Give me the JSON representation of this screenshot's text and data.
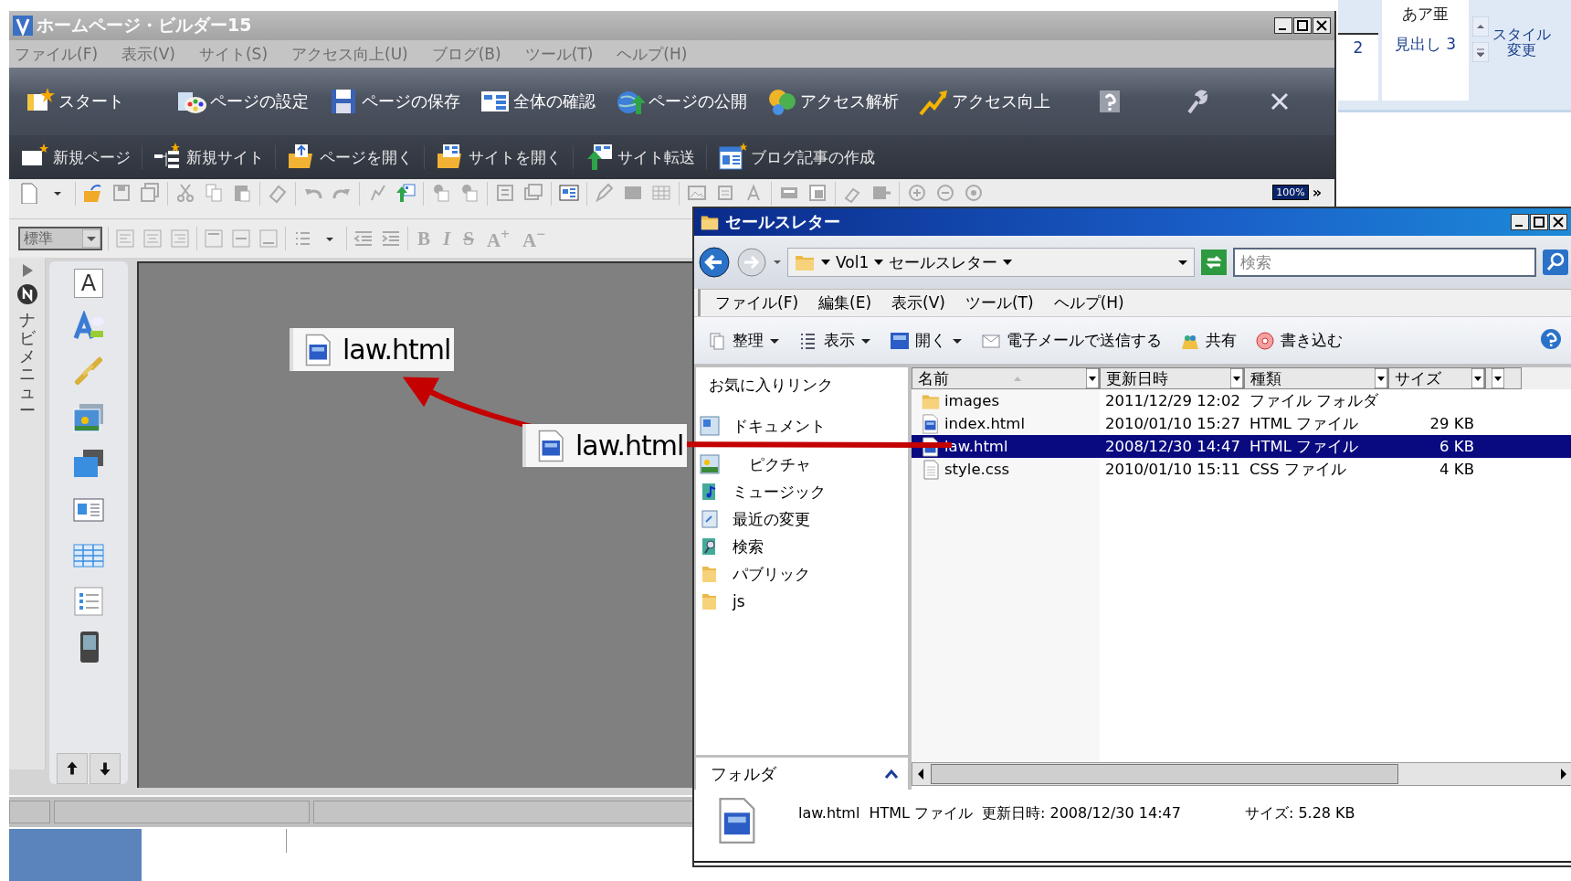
{
  "app": {
    "title": "ホームページ・ビルダー15",
    "menu": [
      "ファイル(F)",
      "表示(V)",
      "サイト(S)",
      "アクセス向上(U)",
      "ブログ(B)",
      "ツール(T)",
      "ヘルプ(H)"
    ],
    "main_toolbar": [
      "スタート",
      "ページの設定",
      "ページの保存",
      "全体の確認",
      "ページの公開",
      "アクセス解析",
      "アクセス向上"
    ],
    "sub_toolbar": [
      "新規ページ",
      "新規サイト",
      "ページを開く",
      "サイトを開く",
      "サイト転送",
      "ブログ記事の作成"
    ],
    "zoom": "100%",
    "more": "»",
    "style_select": "標準",
    "format_buttons": [
      "B",
      "I",
      "S",
      "A$^{+}$",
      "A$^{−}$"
    ],
    "navi_tab": "ナビメニュー",
    "palette_text_tool": "A"
  },
  "canvas_item": "law.html",
  "drag_ghost": "law.html",
  "ribbon": {
    "top": "あア亜",
    "fragment": "2",
    "heading": "見出し 3",
    "style_change": [
      "スタイル",
      "変更"
    ]
  },
  "explorer": {
    "title": "セールスレター",
    "breadcrumb": [
      "Vol1",
      "セールスレター"
    ],
    "search": {
      "placeholder": "検索"
    },
    "menu": [
      "ファイル(F)",
      "編集(E)",
      "表示(V)",
      "ツール(T)",
      "ヘルプ(H)"
    ],
    "toolbar": [
      "整理",
      "表示",
      "開く",
      "電子メールで送信する",
      "共有",
      "書き込む"
    ],
    "favorites_title": "お気に入りリンク",
    "favorites": [
      {
        "label": "ドキュメント",
        "kind": "documents"
      },
      {
        "label": "ピクチャ",
        "kind": "pictures"
      },
      {
        "label": "ミュージック",
        "kind": "music"
      },
      {
        "label": "最近の変更",
        "kind": "recent"
      },
      {
        "label": "検索",
        "kind": "search"
      },
      {
        "label": "パブリック",
        "kind": "folder"
      },
      {
        "label": "js",
        "kind": "folder"
      }
    ],
    "folders_label": "フォルダ",
    "columns": [
      "名前",
      "更新日時",
      "種類",
      "サイズ"
    ],
    "rows": [
      {
        "name": "images",
        "modified": "2011/12/29 12:02",
        "type": "ファイル フォルダ",
        "size": "",
        "kind": "folder",
        "selected": false
      },
      {
        "name": "index.html",
        "modified": "2010/01/10 15:27",
        "type": "HTML ファイル",
        "size": "29 KB",
        "kind": "html",
        "selected": false
      },
      {
        "name": "law.html",
        "modified": "2008/12/30 14:47",
        "type": "HTML ファイル",
        "size": "6 KB",
        "kind": "html",
        "selected": true
      },
      {
        "name": "style.css",
        "modified": "2010/01/10 15:11",
        "type": "CSS ファイル",
        "size": "4 KB",
        "kind": "css",
        "selected": false
      }
    ],
    "details": {
      "name": "law.html",
      "type": "HTML ファイル",
      "modified": "更新日時: 2008/12/30 14:47",
      "size": "サイズ: 5.28 KB"
    }
  }
}
